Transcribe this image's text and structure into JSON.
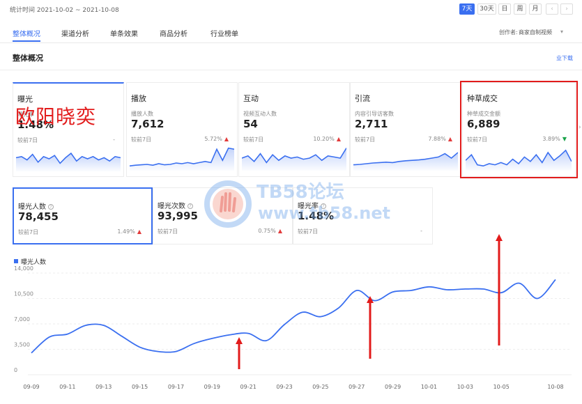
{
  "header": {
    "stat_time": "统计时间 2021-10-02 ~ 2021-10-08",
    "ranges": [
      "7天",
      "30天",
      "日",
      "周",
      "月"
    ],
    "active_range": "7天"
  },
  "nav": {
    "tabs": [
      "整体概况",
      "渠道分析",
      "单条效果",
      "商品分析",
      "行业榜单"
    ],
    "active_tab": "整体概况",
    "creator_label": "创作者:",
    "creator_value": "商家自制视频"
  },
  "section": {
    "title": "整体概况",
    "download": "业下载"
  },
  "overlay": {
    "name_text": "欧阳晓奕",
    "watermark_line1": "TB58论坛",
    "watermark_line2": "www.tb58.net"
  },
  "cards": [
    {
      "title": "曝光",
      "sub": "曝光率",
      "value": "1.48%",
      "compare": "较前7日",
      "pct": "-",
      "trend": "none"
    },
    {
      "title": "播放",
      "sub": "播放人数",
      "value": "7,612",
      "compare": "较前7日",
      "pct": "5.72%",
      "trend": "up"
    },
    {
      "title": "互动",
      "sub": "视频互动人数",
      "value": "54",
      "compare": "较前7日",
      "pct": "10.20%",
      "trend": "up"
    },
    {
      "title": "引流",
      "sub": "内容引导访客数",
      "value": "2,711",
      "compare": "较前7日",
      "pct": "7.88%",
      "trend": "up"
    },
    {
      "title": "种草成交",
      "sub": "种草成交金额",
      "value": "6,889",
      "compare": "较前7日",
      "pct": "3.89%",
      "trend": "down"
    }
  ],
  "subcards": [
    {
      "title": "曝光人数",
      "value": "78,455",
      "compare": "较前7日",
      "pct": "1.49%",
      "trend": "up"
    },
    {
      "title": "曝光次数",
      "value": "93,995",
      "compare": "较前7日",
      "pct": "0.75%",
      "trend": "up"
    },
    {
      "title": "曝光率",
      "value": "1.48%",
      "compare": "较前7日",
      "pct": "-",
      "trend": "none"
    }
  ],
  "icons": {
    "up": "▲",
    "down": "▼",
    "help": "?",
    "chevron_left": "‹",
    "chevron_right": "›",
    "chevron_down": "▾",
    "download": "download-icon"
  },
  "colors": {
    "accent": "#3a6ff0",
    "up": "#e23b3b",
    "down": "#1aa34a",
    "annotation": "#e21b1b"
  },
  "chart_data": {
    "type": "line",
    "series": [
      {
        "name": "曝光人数",
        "x": [
          "09-09",
          "09-10",
          "09-11",
          "09-12",
          "09-13",
          "09-14",
          "09-15",
          "09-16",
          "09-17",
          "09-18",
          "09-19",
          "09-20",
          "09-21",
          "09-22",
          "09-23",
          "09-24",
          "09-25",
          "09-26",
          "09-27",
          "09-28",
          "09-29",
          "09-30",
          "10-01",
          "10-02",
          "10-03",
          "10-04",
          "10-05",
          "10-06",
          "10-07",
          "10-08"
        ],
        "values": [
          3000,
          5200,
          5600,
          6800,
          6800,
          5300,
          3800,
          3200,
          3200,
          4300,
          5000,
          5500,
          5700,
          4700,
          6900,
          8600,
          8000,
          9200,
          11600,
          10200,
          11400,
          11600,
          12100,
          11700,
          11800,
          11800,
          11300,
          12600,
          10500,
          13100
        ]
      }
    ],
    "x_tick_labels": [
      "09-09",
      "09-11",
      "09-13",
      "09-15",
      "09-17",
      "09-19",
      "09-21",
      "09-23",
      "09-25",
      "09-27",
      "09-29",
      "10-01",
      "10-03",
      "10-05",
      "10-08"
    ],
    "y_ticks": [
      0,
      3500,
      7000,
      10500,
      14000
    ],
    "y_tick_labels": [
      "0",
      "3,500",
      "7,000",
      "10,500",
      "14,000"
    ],
    "ylim": [
      0,
      14000
    ],
    "grid": true,
    "legend": "top-left"
  },
  "sparklines": [
    [
      0.55,
      0.6,
      0.45,
      0.7,
      0.35,
      0.6,
      0.5,
      0.65,
      0.3,
      0.55,
      0.75,
      0.4,
      0.6,
      0.5,
      0.6,
      0.45,
      0.55,
      0.4,
      0.6,
      0.55
    ],
    [
      0.15,
      0.18,
      0.2,
      0.22,
      0.18,
      0.25,
      0.2,
      0.22,
      0.28,
      0.25,
      0.3,
      0.25,
      0.3,
      0.35,
      0.3,
      0.9,
      0.4,
      0.95,
      0.9
    ],
    [
      0.5,
      0.6,
      0.35,
      0.7,
      0.3,
      0.65,
      0.4,
      0.6,
      0.5,
      0.55,
      0.45,
      0.5,
      0.65,
      0.4,
      0.6,
      0.55,
      0.5,
      0.95
    ],
    [
      0.2,
      0.22,
      0.25,
      0.28,
      0.3,
      0.32,
      0.3,
      0.35,
      0.38,
      0.4,
      0.42,
      0.45,
      0.5,
      0.55,
      0.7,
      0.5,
      0.75
    ],
    [
      0.4,
      0.65,
      0.2,
      0.15,
      0.25,
      0.2,
      0.3,
      0.2,
      0.45,
      0.25,
      0.55,
      0.35,
      0.65,
      0.3,
      0.75,
      0.4,
      0.6,
      0.85,
      0.35
    ]
  ]
}
